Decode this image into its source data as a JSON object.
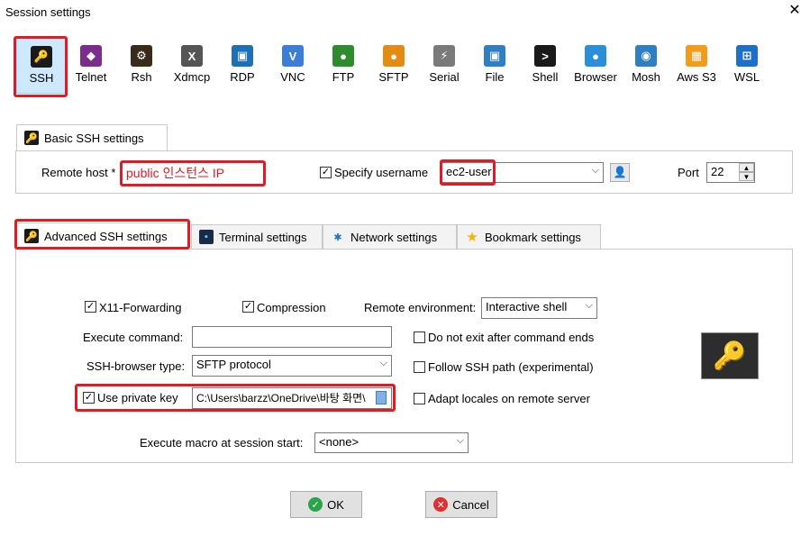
{
  "window": {
    "title": "Session settings",
    "close_glyph": "✕"
  },
  "session_types": [
    {
      "label": "SSH",
      "icon": "ssh-key-icon",
      "color": "#1a1a1a",
      "glyph": "🔑"
    },
    {
      "label": "Telnet",
      "icon": "telnet-icon",
      "color": "#7b2d8b",
      "glyph": "◆"
    },
    {
      "label": "Rsh",
      "icon": "rsh-icon",
      "color": "#3a2a1a",
      "glyph": "⚙"
    },
    {
      "label": "Xdmcp",
      "icon": "xdmcp-icon",
      "color": "#555555",
      "glyph": "X"
    },
    {
      "label": "RDP",
      "icon": "rdp-icon",
      "color": "#1f6fb5",
      "glyph": "▣"
    },
    {
      "label": "VNC",
      "icon": "vnc-icon",
      "color": "#3b7dd8",
      "glyph": "V"
    },
    {
      "label": "FTP",
      "icon": "ftp-icon",
      "color": "#2e8b2e",
      "glyph": "●"
    },
    {
      "label": "SFTP",
      "icon": "sftp-icon",
      "color": "#e38b13",
      "glyph": "●"
    },
    {
      "label": "Serial",
      "icon": "serial-icon",
      "color": "#7a7a7a",
      "glyph": "⚡"
    },
    {
      "label": "File",
      "icon": "file-icon",
      "color": "#2f7fc1",
      "glyph": "▣"
    },
    {
      "label": "Shell",
      "icon": "shell-icon",
      "color": "#1a1a1a",
      "glyph": ">"
    },
    {
      "label": "Browser",
      "icon": "browser-icon",
      "color": "#2a8fd6",
      "glyph": "●"
    },
    {
      "label": "Mosh",
      "icon": "mosh-icon",
      "color": "#2f7fc1",
      "glyph": "◉"
    },
    {
      "label": "Aws S3",
      "icon": "aws-s3-icon",
      "color": "#f29b1d",
      "glyph": "▦"
    },
    {
      "label": "WSL",
      "icon": "wsl-icon",
      "color": "#1e6fc8",
      "glyph": "⊞"
    }
  ],
  "basic": {
    "tab_label": "Basic SSH settings",
    "remote_host_label": "Remote host *",
    "remote_host_value": "public 인스턴스 IP",
    "specify_username_label": "Specify username",
    "specify_username_checked": "✓",
    "username_value": "ec2-user",
    "port_label": "Port",
    "port_value": "22"
  },
  "tabs": [
    {
      "label": "Advanced SSH settings",
      "icon": "ssh-key-icon"
    },
    {
      "label": "Terminal settings",
      "icon": "terminal-icon"
    },
    {
      "label": "Network settings",
      "icon": "network-icon"
    },
    {
      "label": "Bookmark settings",
      "icon": "star-icon"
    }
  ],
  "advanced": {
    "x11_label": "X11-Forwarding",
    "x11_checked": "✓",
    "compression_label": "Compression",
    "compression_checked": "✓",
    "remote_env_label": "Remote environment:",
    "remote_env_value": "Interactive shell",
    "exec_cmd_label": "Execute command:",
    "exec_cmd_value": "",
    "no_exit_label": "Do not exit after command ends",
    "no_exit_checked": "",
    "sshbrowser_label": "SSH-browser type:",
    "sshbrowser_value": "SFTP protocol",
    "follow_path_label": "Follow SSH path (experimental)",
    "follow_path_checked": "",
    "private_key_label": "Use private key",
    "private_key_checked": "✓",
    "private_key_value": "C:\\Users\\barzz\\OneDrive\\바탕 화면\\",
    "adapt_locales_label": "Adapt locales on remote server",
    "adapt_locales_checked": "",
    "macro_label": "Execute macro at session start:",
    "macro_value": "<none>"
  },
  "buttons": {
    "ok": "OK",
    "cancel": "Cancel",
    "ok_glyph": "✓",
    "cancel_glyph": "✕"
  },
  "colors": {
    "highlight_red": "#e01b24",
    "selected_bg": "#cde8ff",
    "ok_green": "#2aa34a",
    "cancel_red": "#e03030"
  }
}
